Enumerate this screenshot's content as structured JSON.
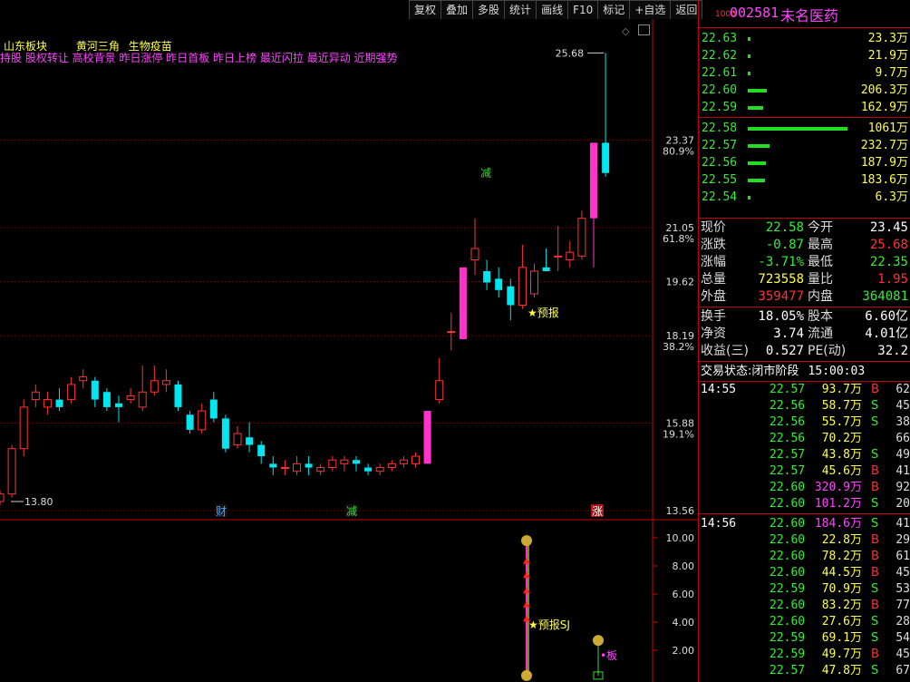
{
  "toolbar": {
    "items": [
      "复权",
      "叠加",
      "多股",
      "统计",
      "画线",
      "F10",
      "标记",
      "+自选",
      "返回"
    ]
  },
  "chart": {
    "concept_tags_line1": [
      "山东板块",
      "黄河三角",
      "生物疫苗"
    ],
    "concept_tags_line2": "持股 股权转让 高校背景 昨日涨停 昨日首板 昨日上榜 最近闪拉 最近异动 近期强势",
    "price_axis": [
      {
        "price": "23.37",
        "pct": "80.9%"
      },
      {
        "price": "21.05",
        "pct": "61.8%"
      },
      {
        "price": "19.62",
        "pct": ""
      },
      {
        "price": "18.19",
        "pct": "38.2%"
      },
      {
        "price": "15.88",
        "pct": "19.1%"
      },
      {
        "price": "13.56",
        "pct": ""
      }
    ],
    "high_label": "25.68",
    "low_label": "13.80",
    "event_markers": [
      {
        "label": "财",
        "color": "#4aa3ff"
      },
      {
        "label": "减",
        "color": "#33dd33"
      },
      {
        "label": "涨",
        "color": "#ffffff"
      }
    ],
    "reduce_label": "减",
    "forecast_label": "★预报",
    "indicator_axis": [
      "10.00",
      "8.00",
      "6.00",
      "4.00",
      "2.00"
    ],
    "indicator_label": "★预报SJ",
    "board_label": "•板",
    "candles": [
      {
        "o": 13.8,
        "c": 14.0,
        "h": 14.1,
        "l": 13.7
      },
      {
        "o": 14.0,
        "c": 15.2,
        "h": 15.3,
        "l": 13.9
      },
      {
        "o": 15.2,
        "c": 16.3,
        "h": 16.5,
        "l": 15.0
      },
      {
        "o": 16.5,
        "c": 16.7,
        "h": 16.9,
        "l": 16.3
      },
      {
        "o": 16.3,
        "c": 16.5,
        "h": 16.7,
        "l": 16.1
      },
      {
        "o": 16.5,
        "c": 16.3,
        "h": 16.8,
        "l": 16.2
      },
      {
        "o": 16.5,
        "c": 16.9,
        "h": 17.1,
        "l": 16.4
      },
      {
        "o": 17.0,
        "c": 17.1,
        "h": 17.3,
        "l": 16.8
      },
      {
        "o": 17.0,
        "c": 16.5,
        "h": 17.1,
        "l": 16.3
      },
      {
        "o": 16.7,
        "c": 16.3,
        "h": 16.8,
        "l": 16.2
      },
      {
        "o": 16.4,
        "c": 16.3,
        "h": 16.6,
        "l": 15.9
      },
      {
        "o": 16.5,
        "c": 16.6,
        "h": 16.8,
        "l": 16.4
      },
      {
        "o": 16.3,
        "c": 16.7,
        "h": 17.4,
        "l": 16.2
      },
      {
        "o": 16.7,
        "c": 17.0,
        "h": 17.4,
        "l": 16.6
      },
      {
        "o": 16.9,
        "c": 17.0,
        "h": 17.3,
        "l": 16.7
      },
      {
        "o": 16.9,
        "c": 16.3,
        "h": 17.0,
        "l": 16.2
      },
      {
        "o": 16.1,
        "c": 15.7,
        "h": 16.2,
        "l": 15.6
      },
      {
        "o": 15.7,
        "c": 16.2,
        "h": 16.4,
        "l": 15.6
      },
      {
        "o": 16.5,
        "c": 16.0,
        "h": 16.7,
        "l": 15.9
      },
      {
        "o": 16.0,
        "c": 15.2,
        "h": 16.1,
        "l": 15.1
      },
      {
        "o": 15.3,
        "c": 15.6,
        "h": 15.8,
        "l": 15.2
      },
      {
        "o": 15.5,
        "c": 15.3,
        "h": 15.9,
        "l": 15.1
      },
      {
        "o": 15.3,
        "c": 15.0,
        "h": 15.4,
        "l": 14.8
      },
      {
        "o": 14.8,
        "c": 14.7,
        "h": 15.0,
        "l": 14.5
      },
      {
        "o": 14.7,
        "c": 14.7,
        "h": 14.9,
        "l": 14.5
      },
      {
        "o": 14.6,
        "c": 14.8,
        "h": 15.0,
        "l": 14.5
      },
      {
        "o": 14.8,
        "c": 14.7,
        "h": 15.0,
        "l": 14.5
      },
      {
        "o": 14.6,
        "c": 14.7,
        "h": 14.8,
        "l": 14.5
      },
      {
        "o": 14.7,
        "c": 14.9,
        "h": 15.0,
        "l": 14.6
      },
      {
        "o": 14.8,
        "c": 14.9,
        "h": 15.0,
        "l": 14.6
      },
      {
        "o": 14.9,
        "c": 14.8,
        "h": 15.0,
        "l": 14.6
      },
      {
        "o": 14.7,
        "c": 14.6,
        "h": 14.8,
        "l": 14.5
      },
      {
        "o": 14.6,
        "c": 14.7,
        "h": 14.8,
        "l": 14.5
      },
      {
        "o": 14.7,
        "c": 14.8,
        "h": 14.9,
        "l": 14.6
      },
      {
        "o": 14.8,
        "c": 14.9,
        "h": 15.0,
        "l": 14.7
      },
      {
        "o": 14.8,
        "c": 15.0,
        "h": 15.1,
        "l": 14.7
      },
      {
        "o": 14.8,
        "c": 16.2,
        "h": 16.2,
        "l": 14.8
      },
      {
        "o": 16.5,
        "c": 17.0,
        "h": 17.6,
        "l": 16.4
      },
      {
        "o": 18.3,
        "c": 18.3,
        "h": 18.8,
        "l": 17.8
      },
      {
        "o": 18.1,
        "c": 20.0,
        "h": 20.0,
        "l": 18.1
      },
      {
        "o": 20.2,
        "c": 20.5,
        "h": 21.3,
        "l": 19.8
      },
      {
        "o": 19.9,
        "c": 19.6,
        "h": 20.2,
        "l": 19.4
      },
      {
        "o": 19.7,
        "c": 19.4,
        "h": 20.0,
        "l": 19.2
      },
      {
        "o": 19.5,
        "c": 19.0,
        "h": 19.7,
        "l": 18.6
      },
      {
        "o": 19.0,
        "c": 20.0,
        "h": 20.6,
        "l": 18.9
      },
      {
        "o": 19.3,
        "c": 19.9,
        "h": 20.1,
        "l": 19.2
      },
      {
        "o": 20.0,
        "c": 19.9,
        "h": 20.5,
        "l": 19.9
      },
      {
        "o": 20.3,
        "c": 20.3,
        "h": 21.1,
        "l": 19.9
      },
      {
        "o": 20.2,
        "c": 20.4,
        "h": 20.7,
        "l": 20.0
      },
      {
        "o": 20.3,
        "c": 21.3,
        "h": 21.5,
        "l": 20.2
      },
      {
        "o": 21.3,
        "c": 23.3,
        "h": 23.3,
        "l": 20.0
      },
      {
        "o": 23.3,
        "c": 22.5,
        "h": 25.68,
        "l": 22.4
      }
    ]
  },
  "stock": {
    "code": "002581",
    "name": "未名医药",
    "prefix": "1000"
  },
  "order_book": [
    {
      "price": "22.63",
      "vol": "23.3万",
      "bar": 0.005
    },
    {
      "price": "22.62",
      "vol": "21.9万",
      "bar": 0.005
    },
    {
      "price": "22.61",
      "vol": "9.7万",
      "bar": 0.003
    },
    {
      "price": "22.60",
      "vol": "206.3万",
      "bar": 0.19
    },
    {
      "price": "22.59",
      "vol": "162.9万",
      "bar": 0.15
    },
    {
      "price": "22.58",
      "vol": "1061万",
      "bar": 1.0
    },
    {
      "price": "22.57",
      "vol": "232.7万",
      "bar": 0.22
    },
    {
      "price": "22.56",
      "vol": "187.9万",
      "bar": 0.18
    },
    {
      "price": "22.55",
      "vol": "183.6万",
      "bar": 0.17
    },
    {
      "price": "22.54",
      "vol": "6.3万",
      "bar": 0.005
    }
  ],
  "quote": [
    {
      "l1": "现价",
      "v1": "22.58",
      "c1": "#33ee33",
      "l2": "今开",
      "v2": "23.45",
      "c2": "#ffffff"
    },
    {
      "l1": "涨跌",
      "v1": "-0.87",
      "c1": "#33ee33",
      "l2": "最高",
      "v2": "25.68",
      "c2": "#ff3333"
    },
    {
      "l1": "涨幅",
      "v1": "-3.71%",
      "c1": "#33ee33",
      "l2": "最低",
      "v2": "22.35",
      "c2": "#33ee33"
    },
    {
      "l1": "总量",
      "v1": "723558",
      "c1": "#ffff44",
      "l2": "量比",
      "v2": "1.95",
      "c2": "#ff3333"
    },
    {
      "l1": "外盘",
      "v1": "359477",
      "c1": "#ff3333",
      "l2": "内盘",
      "v2": "364081",
      "c2": "#33ee33"
    }
  ],
  "fundamentals": [
    {
      "l1": "换手",
      "v1": "18.05%",
      "l2": "股本",
      "v2": "6.60亿"
    },
    {
      "l1": "净资",
      "v1": "3.74",
      "l2": "流通",
      "v2": "4.01亿"
    },
    {
      "l1": "收益(三)",
      "v1": "0.527",
      "l2": "PE(动)",
      "v2": "32.2"
    }
  ],
  "trade_status": {
    "label": "交易状态:",
    "value": "闭市阶段",
    "time": "15:00:03"
  },
  "ticks": [
    {
      "t": "14:55",
      "p": "22.57",
      "v": "93.7万",
      "s": "B",
      "n": "62",
      "vc": "#ffff44"
    },
    {
      "t": "",
      "p": "22.56",
      "v": "58.7万",
      "s": "S",
      "n": "45",
      "vc": "#ffff44"
    },
    {
      "t": "",
      "p": "22.56",
      "v": "55.7万",
      "s": "S",
      "n": "38",
      "vc": "#ffff44"
    },
    {
      "t": "",
      "p": "22.56",
      "v": "70.2万",
      "s": "",
      "n": "66",
      "vc": "#ffff44"
    },
    {
      "t": "",
      "p": "22.57",
      "v": "43.8万",
      "s": "S",
      "n": "49",
      "vc": "#ffff44"
    },
    {
      "t": "",
      "p": "22.57",
      "v": "45.6万",
      "s": "B",
      "n": "41",
      "vc": "#ffff44"
    },
    {
      "t": "",
      "p": "22.60",
      "v": "320.9万",
      "s": "B",
      "n": "92",
      "vc": "#ff44ff"
    },
    {
      "t": "",
      "p": "22.60",
      "v": "101.2万",
      "s": "S",
      "n": "20",
      "vc": "#ff44ff"
    },
    {
      "t": "14:56",
      "p": "22.60",
      "v": "184.6万",
      "s": "S",
      "n": "41",
      "vc": "#ff44ff"
    },
    {
      "t": "",
      "p": "22.60",
      "v": "22.8万",
      "s": "B",
      "n": "29",
      "vc": "#ffff44"
    },
    {
      "t": "",
      "p": "22.60",
      "v": "78.2万",
      "s": "B",
      "n": "61",
      "vc": "#ffff44"
    },
    {
      "t": "",
      "p": "22.60",
      "v": "44.5万",
      "s": "B",
      "n": "45",
      "vc": "#ffff44"
    },
    {
      "t": "",
      "p": "22.59",
      "v": "70.9万",
      "s": "S",
      "n": "53",
      "vc": "#ffff44"
    },
    {
      "t": "",
      "p": "22.60",
      "v": "83.2万",
      "s": "B",
      "n": "77",
      "vc": "#ffff44"
    },
    {
      "t": "",
      "p": "22.60",
      "v": "27.6万",
      "s": "S",
      "n": "28",
      "vc": "#ffff44"
    },
    {
      "t": "",
      "p": "22.59",
      "v": "69.1万",
      "s": "S",
      "n": "54",
      "vc": "#ffff44"
    },
    {
      "t": "",
      "p": "22.59",
      "v": "49.7万",
      "s": "B",
      "n": "45",
      "vc": "#ffff44"
    },
    {
      "t": "",
      "p": "22.57",
      "v": "47.8万",
      "s": "S",
      "n": "67",
      "vc": "#ffff44"
    }
  ],
  "colors": {
    "up": "#ff3333",
    "down": "#00e5ee",
    "limit": "#ff33cc",
    "grid": "#8b0000",
    "axis": "#cc0000"
  }
}
